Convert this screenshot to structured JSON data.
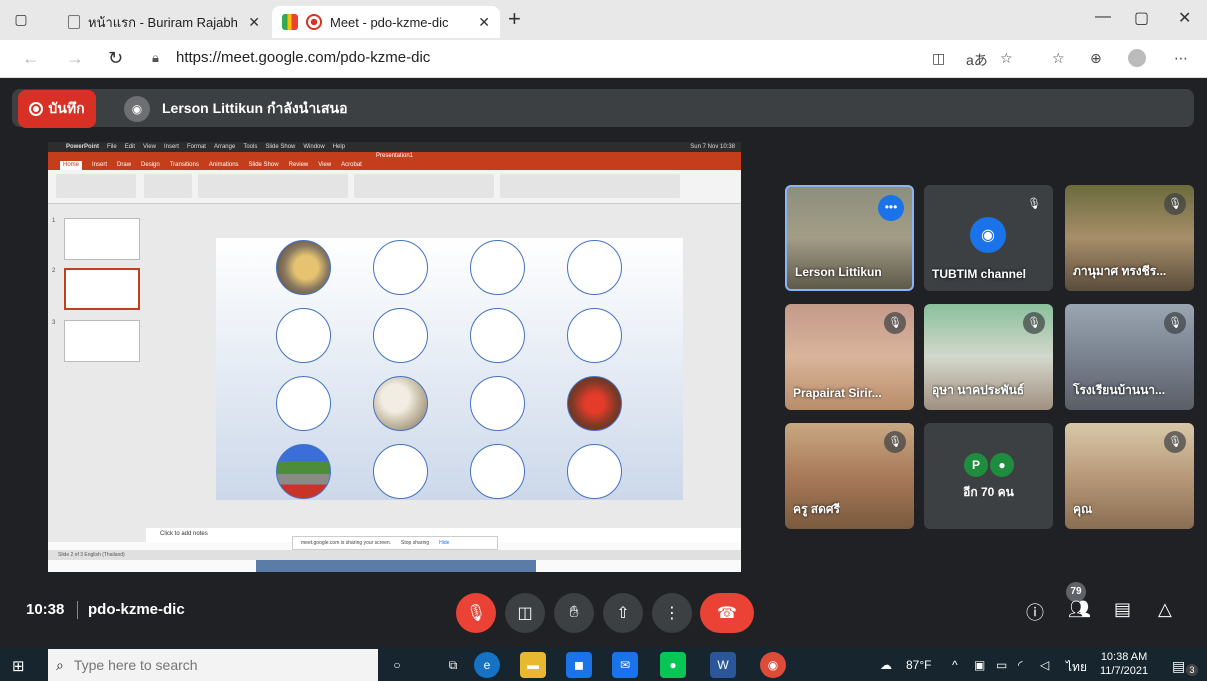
{
  "browser": {
    "tabs": [
      {
        "title": "หน้าแรก - Buriram Rajabhat Unive",
        "active": false
      },
      {
        "title": "Meet - pdo-kzme-dic",
        "active": true
      }
    ],
    "new_tab_symbol": "+",
    "url": "https://meet.google.com/pdo-kzme-dic",
    "window_controls": {
      "minimize": "—",
      "maximize": "▢",
      "close": "✕"
    },
    "address_icons": {
      "read_aloud": "aあ"
    }
  },
  "meet": {
    "record_label": "บันทึก",
    "presenter_text": "Lerson Littikun กำลังนำเสนอ",
    "time": "10:38",
    "meeting_code": "pdo-kzme-dic",
    "participant_count": "79"
  },
  "screen": {
    "mac_menu": [
      "PowerPoint",
      "File",
      "Edit",
      "View",
      "Insert",
      "Format",
      "Arrange",
      "Tools",
      "Slide Show",
      "Window",
      "Help"
    ],
    "mac_clock": "Sun 7 Nov 10:38",
    "doc_title": "Presentation1",
    "ribbon_tabs": [
      "Home",
      "Insert",
      "Draw",
      "Design",
      "Transitions",
      "Animations",
      "Slide Show",
      "Review",
      "View",
      "Acrobat"
    ],
    "thumb_numbers": [
      "1",
      "2",
      "3"
    ],
    "notes_placeholder": "Click to add notes",
    "share_text": "meet.google.com is sharing your screen.",
    "stop_sharing": "Stop sharing",
    "hide": "Hide",
    "status_text": "Slide 2 of 3   English (Thailand)"
  },
  "participants": [
    {
      "name": "Lerson Littikun"
    },
    {
      "name": "TUBTIM channel"
    },
    {
      "name": "ภานุมาศ ทรงชีร..."
    },
    {
      "name": "Prapairat Sirir..."
    },
    {
      "name": "อุษา นาคประพันธ์"
    },
    {
      "name": "โรงเรียนบ้านนา..."
    },
    {
      "name": "ครู สดศรี"
    },
    {
      "name": "อีก 70 คน",
      "initials": [
        "P"
      ]
    },
    {
      "name": "คุณ"
    }
  ],
  "taskbar": {
    "search_placeholder": "Type here to search",
    "weather": "87°F",
    "lang": "ไทย",
    "time": "10:38 AM",
    "date": "11/7/2021",
    "notifications": "3"
  },
  "colors": {
    "meet_bg": "#202124",
    "record_red": "#d93025",
    "hangup_red": "#ea4335",
    "ppt_orange": "#c43e1c",
    "accent_blue": "#1a73e8"
  }
}
